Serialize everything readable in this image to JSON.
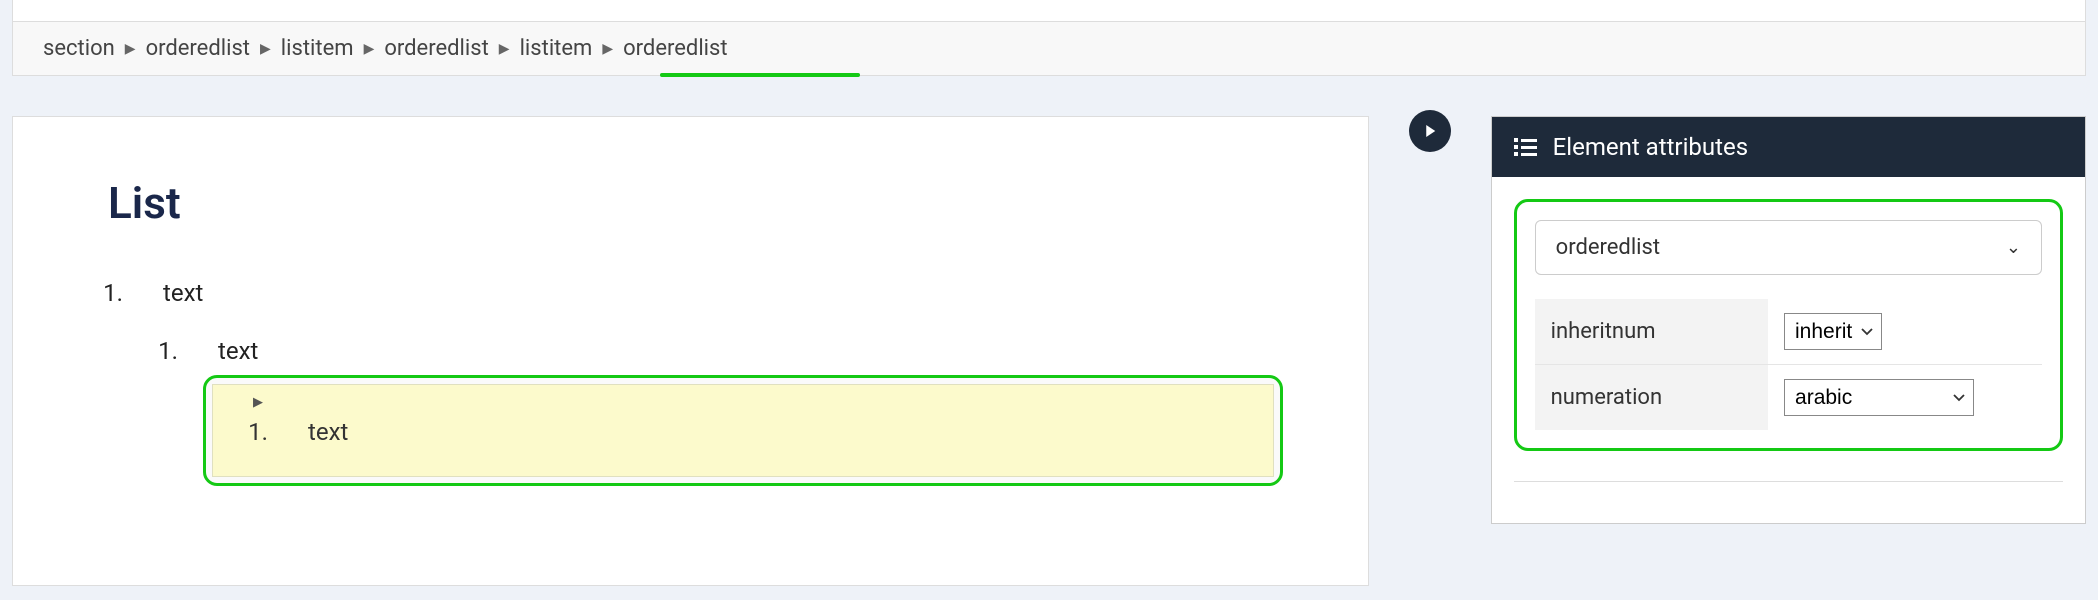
{
  "breadcrumb": {
    "items": [
      "section",
      "orderedlist",
      "listitem",
      "orderedlist",
      "listitem",
      "orderedlist"
    ]
  },
  "document": {
    "title": "List",
    "lvl1": {
      "marker": "1.",
      "text": "text"
    },
    "lvl2": {
      "marker": "1.",
      "text": "text"
    },
    "lvl3": {
      "marker": "1.",
      "text": "text"
    }
  },
  "panel": {
    "title": "Element attributes",
    "element_name": "orderedlist",
    "attributes": [
      {
        "label": "inheritnum",
        "value": "inherit"
      },
      {
        "label": "numeration",
        "value": "arabic"
      }
    ]
  }
}
